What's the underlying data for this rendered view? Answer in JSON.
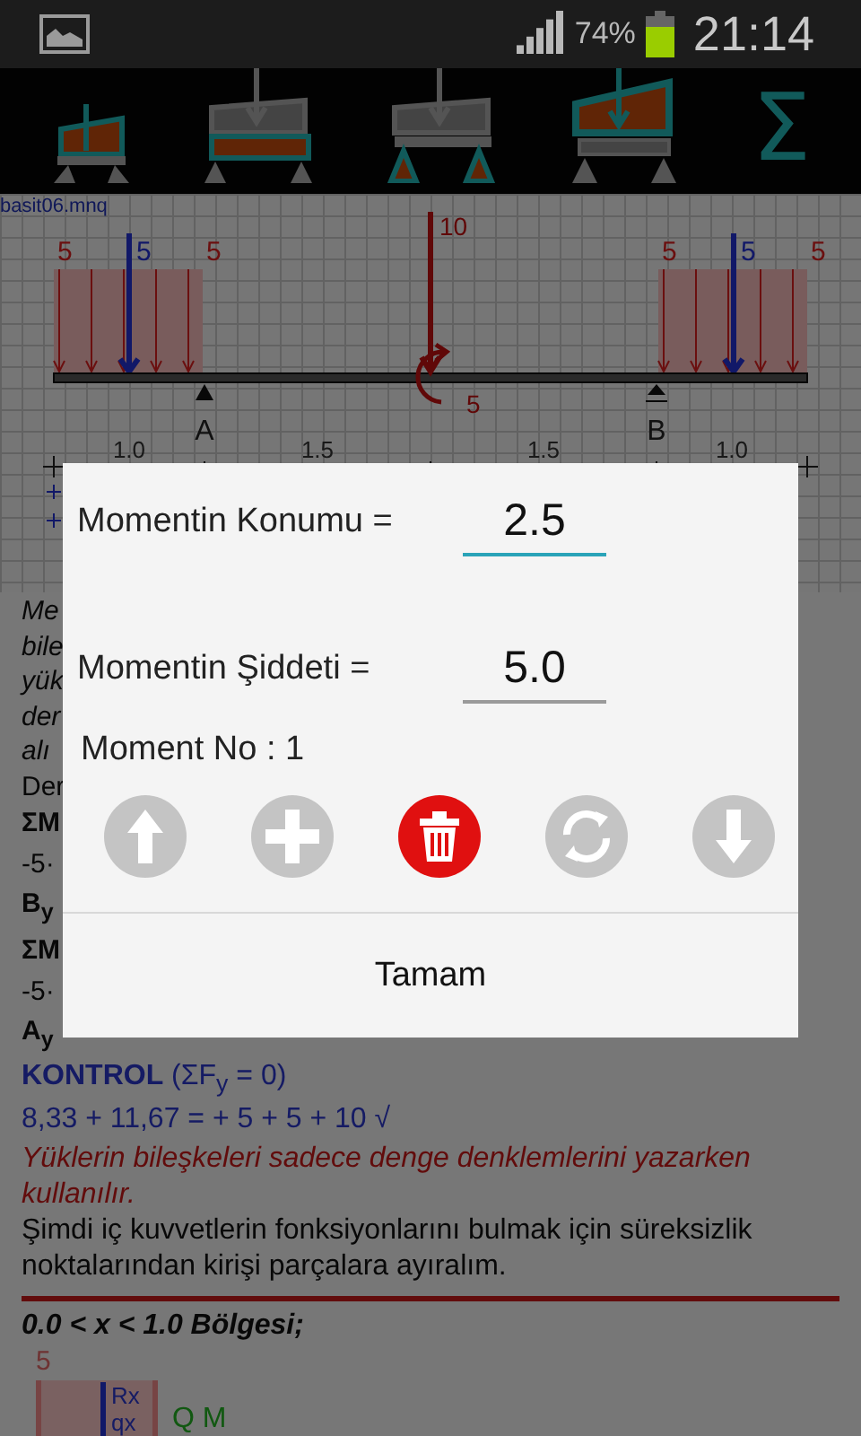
{
  "status_bar": {
    "battery_text": "74%",
    "time": "21:14"
  },
  "toolbar": {
    "tools": [
      {
        "kind": "frame-small"
      },
      {
        "kind": "beam-grey"
      },
      {
        "kind": "beam-supports"
      },
      {
        "kind": "frame-large"
      },
      {
        "kind": "symbol",
        "symbol": "Σ"
      }
    ]
  },
  "diagram": {
    "file_name": "basit06.mnq",
    "distributed_loads": [
      {
        "start": "5",
        "resultant": "5",
        "end": "5"
      },
      {
        "start": "5",
        "resultant": "5",
        "end": "5"
      }
    ],
    "point_load": "10",
    "moment": "5",
    "supports": [
      {
        "label": "A",
        "kind": "pin"
      },
      {
        "label": "B",
        "kind": "roller"
      }
    ],
    "spans": [
      "1.0",
      "1.5",
      "1.5",
      "1.0"
    ]
  },
  "solution": {
    "fragments": [
      {
        "kind": "italic",
        "text": "Me"
      },
      {
        "kind": "italic",
        "text": "bile"
      },
      {
        "kind": "italic",
        "text": "yük"
      },
      {
        "kind": "italic",
        "text": "der"
      },
      {
        "kind": "italic",
        "text": "alı"
      },
      {
        "kind": "plain",
        "text": "Der"
      },
      {
        "kind": "bold",
        "text": "ΣM"
      },
      {
        "kind": "formula",
        "text": "-5·"
      },
      {
        "kind": "bold",
        "text": "B$_{y}$"
      },
      {
        "kind": "bold",
        "text": "ΣM"
      },
      {
        "kind": "formula",
        "text": "-5·"
      },
      {
        "kind": "bold",
        "text": "A$_{y}$"
      }
    ],
    "lines": [
      {
        "kind": "check",
        "text": "**KONTROL** (ΣF$_{y}$ = 0)"
      },
      {
        "kind": "check",
        "text": "8,33 + 11,67 = + 5 + 5 + 10 √"
      },
      {
        "kind": "note",
        "text": "Yüklerin bileşkeleri sadece denge denklemlerini yazarken kullanılır."
      },
      {
        "kind": "plain",
        "text": "Şimdi iç kuvvetlerin fonksiyonlarını bulmak için süreksizlik noktalarından kirişi parçalara ayıralım."
      }
    ],
    "section_title": "0.0 < x < 1.0 Bölgesi;",
    "section_diagram": {
      "load": "5",
      "labels": [
        "Rx",
        "qx"
      ],
      "cut_label": "Q M"
    }
  },
  "dialog": {
    "fields": [
      {
        "label": "Momentin Konumu =",
        "value": "2.5",
        "focused": true
      },
      {
        "label": "Momentin Şiddeti =",
        "value": "5.0",
        "focused": false
      }
    ],
    "moment_no": "Moment No : 1",
    "actions": [
      {
        "kind": "up",
        "highlighted": false
      },
      {
        "kind": "add",
        "highlighted": false
      },
      {
        "kind": "delete",
        "highlighted": true
      },
      {
        "kind": "refresh",
        "highlighted": false
      },
      {
        "kind": "down",
        "highlighted": false
      }
    ],
    "ok_button": "Tamam"
  }
}
